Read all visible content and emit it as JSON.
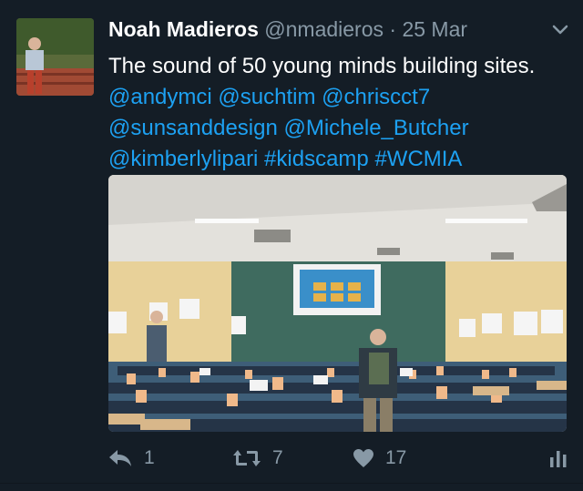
{
  "tweet": {
    "author_name": "Noah Madieros",
    "handle": "@nmadieros",
    "separator": "·",
    "date": "25 Mar",
    "text_line1": "The sound of 50 young minds building sites.",
    "mentions_line2": "@andymci @suchtim @chriscct7",
    "mentions_line3": "@sunsanddesign @Michele_Butcher",
    "mentions_line4": "@kimberlylipari #kidscamp #WCMIA"
  },
  "actions": {
    "reply_count": "1",
    "retweet_count": "7",
    "like_count": "17"
  },
  "colors": {
    "background": "#141d26",
    "link": "#1da1f2",
    "muted": "#8899a6"
  }
}
